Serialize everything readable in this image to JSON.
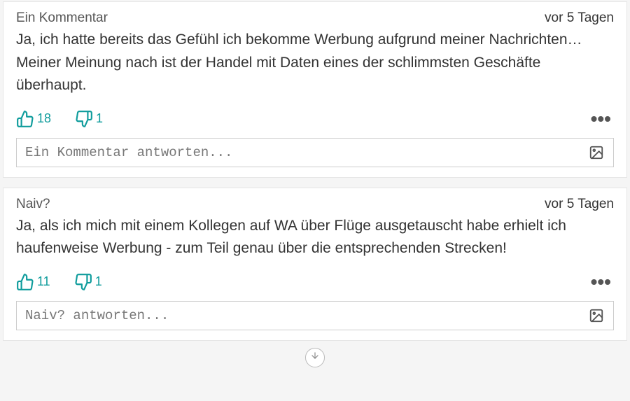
{
  "accent": "#0f9c9c",
  "comments": [
    {
      "author": "Ein Kommentar",
      "time": "vor 5 Tagen",
      "body": "Ja, ich hatte bereits das Gefühl ich bekomme Werbung aufgrund meiner Nachrichten… Meiner Meinung nach ist der Handel mit Daten eines der schlimmsten Geschäfte überhaupt.",
      "upvotes": "18",
      "downvotes": "1",
      "reply_placeholder": "Ein Kommentar antworten..."
    },
    {
      "author": "Naiv?",
      "time": "vor 5 Tagen",
      "body": "Ja, als ich mich mit einem Kollegen auf WA über Flüge ausgetauscht habe erhielt ich haufenweise Werbung - zum Teil genau über die entsprechenden Strecken!",
      "upvotes": "11",
      "downvotes": "1",
      "reply_placeholder": "Naiv? antworten..."
    }
  ],
  "icons": {
    "thumbs_up": "thumbs-up-icon",
    "thumbs_down": "thumbs-down-icon",
    "more": "more-icon",
    "image": "image-icon",
    "arrow_down": "arrow-down-icon"
  }
}
